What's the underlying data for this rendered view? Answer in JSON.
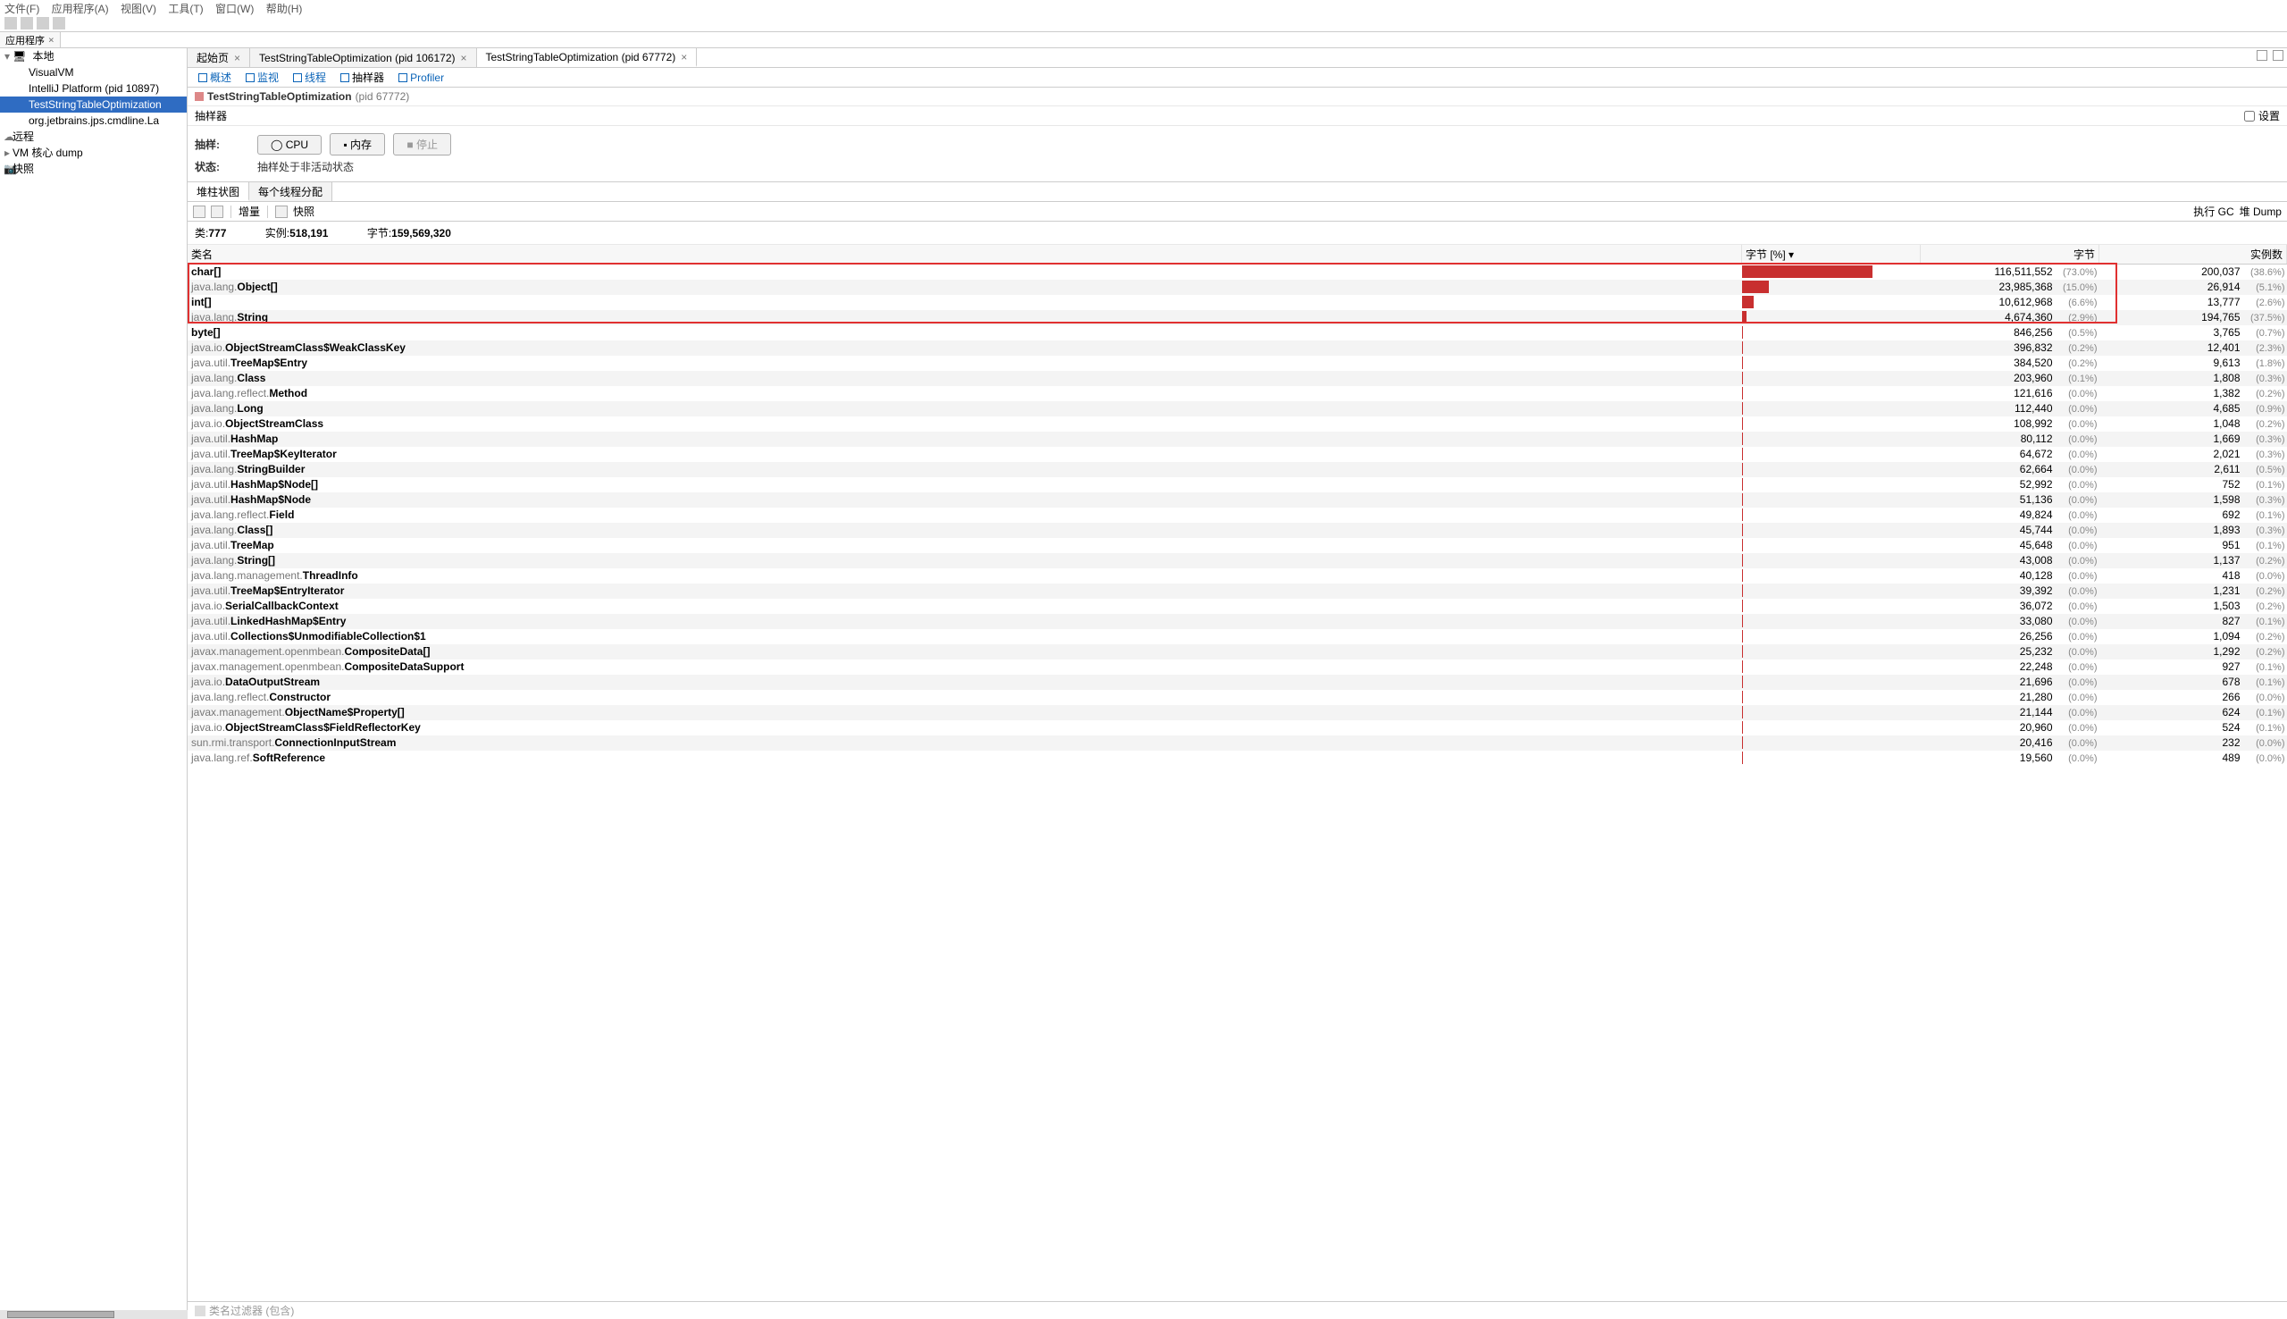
{
  "menubar": [
    "文件(F)",
    "应用程序(A)",
    "视图(V)",
    "工具(T)",
    "窗口(W)",
    "帮助(H)"
  ],
  "app_tabs": {
    "tab0": "应用程序"
  },
  "tree": {
    "local": "本地",
    "visualvm": "VisualVM",
    "intellij": "IntelliJ Platform (pid 10897)",
    "selected": "TestStringTableOptimization",
    "jps": "org.jetbrains.jps.cmdline.La",
    "remote": "远程",
    "vmdump": "VM 核心 dump",
    "snap": "快照"
  },
  "main_tabs": {
    "tab0": "起始页",
    "tab1": "TestStringTableOptimization (pid 106172)",
    "tab2": "TestStringTableOptimization (pid 67772)"
  },
  "subnav": {
    "overview": "概述",
    "monitor": "监视",
    "threads": "线程",
    "sampler": "抽样器",
    "profiler": "Profiler"
  },
  "pid_line": {
    "name": "TestStringTableOptimization",
    "pid": "(pid 67772)"
  },
  "settings_row": {
    "label": "抽样器",
    "chk": "设置"
  },
  "sample_block": {
    "sample_lbl": "抽样:",
    "cpu": "CPU",
    "mem": "内存",
    "stop": "停止",
    "state_lbl": "状态:",
    "state_txt": "抽样处于非活动状态"
  },
  "tabs2": {
    "t0": "堆柱状图",
    "t1": "每个线程分配"
  },
  "toolbar2": {
    "delta": "增量",
    "snap": "快照",
    "gc": "执行 GC",
    "heap": "堆 Dump"
  },
  "summary_labels": {
    "classes": "类:",
    "inst": "实例:",
    "bytes": "字节:"
  },
  "summary_values": {
    "classes": "777",
    "inst": "518,191",
    "bytes": "159,569,320"
  },
  "headers": {
    "name": "类名",
    "bytepct": "字节 [%] ▾",
    "bytes": "字节",
    "inst": "实例数"
  },
  "filter": "类名过滤器 (包含)",
  "rows": [
    {
      "pkg": "",
      "cls": "char[]",
      "barw": 73,
      "bytes": "116,511,552",
      "bpct": "(73.0%)",
      "inst": "200,037",
      "ipct": "(38.6%)",
      "hl": 1
    },
    {
      "pkg": "java.lang.",
      "cls": "Object[]",
      "barw": 15,
      "bytes": "23,985,368",
      "bpct": "(15.0%)",
      "inst": "26,914",
      "ipct": "(5.1%)",
      "hl": 1
    },
    {
      "pkg": "",
      "cls": "int[]",
      "barw": 6.6,
      "bytes": "10,612,968",
      "bpct": "(6.6%)",
      "inst": "13,777",
      "ipct": "(2.6%)",
      "hl": 1
    },
    {
      "pkg": "java.lang.",
      "cls": "String",
      "barw": 2.9,
      "bytes": "4,674,360",
      "bpct": "(2.9%)",
      "inst": "194,765",
      "ipct": "(37.5%)",
      "hl": 1
    },
    {
      "pkg": "",
      "cls": "byte[]",
      "barw": 0,
      "bytes": "846,256",
      "bpct": "(0.5%)",
      "inst": "3,765",
      "ipct": "(0.7%)"
    },
    {
      "pkg": "java.io.",
      "cls": "ObjectStreamClass$WeakClassKey",
      "barw": 0,
      "bytes": "396,832",
      "bpct": "(0.2%)",
      "inst": "12,401",
      "ipct": "(2.3%)"
    },
    {
      "pkg": "java.util.",
      "cls": "TreeMap$Entry",
      "barw": 0,
      "bytes": "384,520",
      "bpct": "(0.2%)",
      "inst": "9,613",
      "ipct": "(1.8%)"
    },
    {
      "pkg": "java.lang.",
      "cls": "Class",
      "barw": 0,
      "bytes": "203,960",
      "bpct": "(0.1%)",
      "inst": "1,808",
      "ipct": "(0.3%)"
    },
    {
      "pkg": "java.lang.reflect.",
      "cls": "Method",
      "barw": 0,
      "bytes": "121,616",
      "bpct": "(0.0%)",
      "inst": "1,382",
      "ipct": "(0.2%)"
    },
    {
      "pkg": "java.lang.",
      "cls": "Long",
      "barw": 0,
      "bytes": "112,440",
      "bpct": "(0.0%)",
      "inst": "4,685",
      "ipct": "(0.9%)"
    },
    {
      "pkg": "java.io.",
      "cls": "ObjectStreamClass",
      "barw": 0,
      "bytes": "108,992",
      "bpct": "(0.0%)",
      "inst": "1,048",
      "ipct": "(0.2%)"
    },
    {
      "pkg": "java.util.",
      "cls": "HashMap",
      "barw": 0,
      "bytes": "80,112",
      "bpct": "(0.0%)",
      "inst": "1,669",
      "ipct": "(0.3%)"
    },
    {
      "pkg": "java.util.",
      "cls": "TreeMap$KeyIterator",
      "barw": 0,
      "bytes": "64,672",
      "bpct": "(0.0%)",
      "inst": "2,021",
      "ipct": "(0.3%)"
    },
    {
      "pkg": "java.lang.",
      "cls": "StringBuilder",
      "barw": 0,
      "bytes": "62,664",
      "bpct": "(0.0%)",
      "inst": "2,611",
      "ipct": "(0.5%)"
    },
    {
      "pkg": "java.util.",
      "cls": "HashMap$Node[]",
      "barw": 0,
      "bytes": "52,992",
      "bpct": "(0.0%)",
      "inst": "752",
      "ipct": "(0.1%)"
    },
    {
      "pkg": "java.util.",
      "cls": "HashMap$Node",
      "barw": 0,
      "bytes": "51,136",
      "bpct": "(0.0%)",
      "inst": "1,598",
      "ipct": "(0.3%)"
    },
    {
      "pkg": "java.lang.reflect.",
      "cls": "Field",
      "barw": 0,
      "bytes": "49,824",
      "bpct": "(0.0%)",
      "inst": "692",
      "ipct": "(0.1%)"
    },
    {
      "pkg": "java.lang.",
      "cls": "Class[]",
      "barw": 0,
      "bytes": "45,744",
      "bpct": "(0.0%)",
      "inst": "1,893",
      "ipct": "(0.3%)"
    },
    {
      "pkg": "java.util.",
      "cls": "TreeMap",
      "barw": 0,
      "bytes": "45,648",
      "bpct": "(0.0%)",
      "inst": "951",
      "ipct": "(0.1%)"
    },
    {
      "pkg": "java.lang.",
      "cls": "String[]",
      "barw": 0,
      "bytes": "43,008",
      "bpct": "(0.0%)",
      "inst": "1,137",
      "ipct": "(0.2%)"
    },
    {
      "pkg": "java.lang.management.",
      "cls": "ThreadInfo",
      "barw": 0,
      "bytes": "40,128",
      "bpct": "(0.0%)",
      "inst": "418",
      "ipct": "(0.0%)"
    },
    {
      "pkg": "java.util.",
      "cls": "TreeMap$EntryIterator",
      "barw": 0,
      "bytes": "39,392",
      "bpct": "(0.0%)",
      "inst": "1,231",
      "ipct": "(0.2%)"
    },
    {
      "pkg": "java.io.",
      "cls": "SerialCallbackContext",
      "barw": 0,
      "bytes": "36,072",
      "bpct": "(0.0%)",
      "inst": "1,503",
      "ipct": "(0.2%)"
    },
    {
      "pkg": "java.util.",
      "cls": "LinkedHashMap$Entry",
      "barw": 0,
      "bytes": "33,080",
      "bpct": "(0.0%)",
      "inst": "827",
      "ipct": "(0.1%)"
    },
    {
      "pkg": "java.util.",
      "cls": "Collections$UnmodifiableCollection$1",
      "barw": 0,
      "bytes": "26,256",
      "bpct": "(0.0%)",
      "inst": "1,094",
      "ipct": "(0.2%)"
    },
    {
      "pkg": "javax.management.openmbean.",
      "cls": "CompositeData[]",
      "barw": 0,
      "bytes": "25,232",
      "bpct": "(0.0%)",
      "inst": "1,292",
      "ipct": "(0.2%)"
    },
    {
      "pkg": "javax.management.openmbean.",
      "cls": "CompositeDataSupport",
      "barw": 0,
      "bytes": "22,248",
      "bpct": "(0.0%)",
      "inst": "927",
      "ipct": "(0.1%)"
    },
    {
      "pkg": "java.io.",
      "cls": "DataOutputStream",
      "barw": 0,
      "bytes": "21,696",
      "bpct": "(0.0%)",
      "inst": "678",
      "ipct": "(0.1%)"
    },
    {
      "pkg": "java.lang.reflect.",
      "cls": "Constructor",
      "barw": 0,
      "bytes": "21,280",
      "bpct": "(0.0%)",
      "inst": "266",
      "ipct": "(0.0%)"
    },
    {
      "pkg": "javax.management.",
      "cls": "ObjectName$Property[]",
      "barw": 0,
      "bytes": "21,144",
      "bpct": "(0.0%)",
      "inst": "624",
      "ipct": "(0.1%)"
    },
    {
      "pkg": "java.io.",
      "cls": "ObjectStreamClass$FieldReflectorKey",
      "barw": 0,
      "bytes": "20,960",
      "bpct": "(0.0%)",
      "inst": "524",
      "ipct": "(0.1%)"
    },
    {
      "pkg": "sun.rmi.transport.",
      "cls": "ConnectionInputStream",
      "barw": 0,
      "bytes": "20,416",
      "bpct": "(0.0%)",
      "inst": "232",
      "ipct": "(0.0%)"
    },
    {
      "pkg": "java.lang.ref.",
      "cls": "SoftReference",
      "barw": 0,
      "bytes": "19,560",
      "bpct": "(0.0%)",
      "inst": "489",
      "ipct": "(0.0%)"
    }
  ]
}
